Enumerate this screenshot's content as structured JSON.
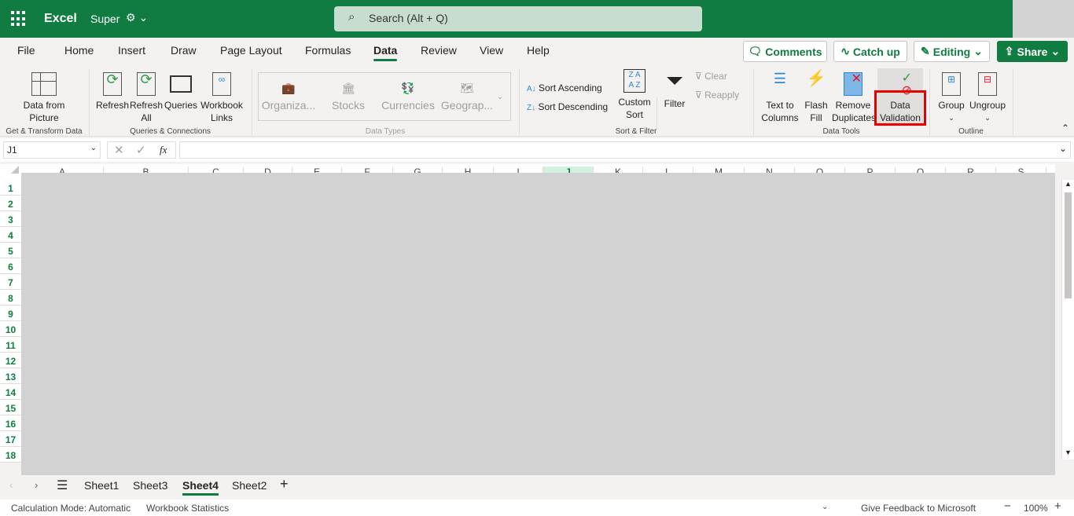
{
  "app": {
    "name": "Excel",
    "file_name": "Super",
    "search_placeholder": "Search (Alt + Q)"
  },
  "tabs": [
    {
      "label": "File"
    },
    {
      "label": "Home"
    },
    {
      "label": "Insert"
    },
    {
      "label": "Draw"
    },
    {
      "label": "Page Layout"
    },
    {
      "label": "Formulas"
    },
    {
      "label": "Data",
      "active": true
    },
    {
      "label": "Review"
    },
    {
      "label": "View"
    },
    {
      "label": "Help"
    }
  ],
  "top_buttons": {
    "comments": "Comments",
    "catch_up": "Catch up",
    "editing": "Editing",
    "share": "Share"
  },
  "ribbon": {
    "get_transform": {
      "label": "Get & Transform Data",
      "data_from_picture": [
        "Data from",
        "Picture"
      ]
    },
    "queries": {
      "label": "Queries & Connections",
      "refresh": "Refresh",
      "refresh_all": [
        "Refresh",
        "All"
      ],
      "queries": "Queries",
      "workbook_links": [
        "Workbook",
        "Links"
      ]
    },
    "data_types": {
      "label": "Data Types",
      "items": [
        "Organiza...",
        "Stocks",
        "Currencies",
        "Geograp..."
      ]
    },
    "sort_filter": {
      "label": "Sort & Filter",
      "sort_asc": "Sort Ascending",
      "sort_desc": "Sort Descending",
      "custom_sort": [
        "Custom",
        "Sort"
      ],
      "filter": "Filter",
      "clear": "Clear",
      "reapply": "Reapply"
    },
    "data_tools": {
      "label": "Data Tools",
      "text_to_columns": [
        "Text to",
        "Columns"
      ],
      "flash_fill": [
        "Flash",
        "Fill"
      ],
      "remove_duplicates": [
        "Remove",
        "Duplicates"
      ],
      "data_validation": [
        "Data",
        "Validation"
      ]
    },
    "outline": {
      "label": "Outline",
      "group": "Group",
      "ungroup": "Ungroup"
    }
  },
  "formula_bar": {
    "name_box": "J1",
    "fx": "fx",
    "value": ""
  },
  "columns": [
    "A",
    "B",
    "C",
    "D",
    "E",
    "F",
    "G",
    "H",
    "I",
    "J",
    "K",
    "L",
    "M",
    "N",
    "O",
    "P",
    "Q",
    "R",
    "S"
  ],
  "rows": [
    "1",
    "2",
    "3",
    "4",
    "5",
    "6",
    "7",
    "8",
    "9",
    "10",
    "11",
    "12",
    "13",
    "14",
    "15",
    "16",
    "17",
    "18"
  ],
  "selected_column": "J",
  "sheets": [
    {
      "label": "Sheet1"
    },
    {
      "label": "Sheet3"
    },
    {
      "label": "Sheet4",
      "active": true
    },
    {
      "label": "Sheet2"
    }
  ],
  "status": {
    "calc_mode": "Calculation Mode: Automatic",
    "workbook_stats": "Workbook Statistics",
    "feedback": "Give Feedback to Microsoft",
    "zoom": "100%"
  },
  "colors": {
    "brand": "#107c41",
    "highlight": "#e60000"
  }
}
